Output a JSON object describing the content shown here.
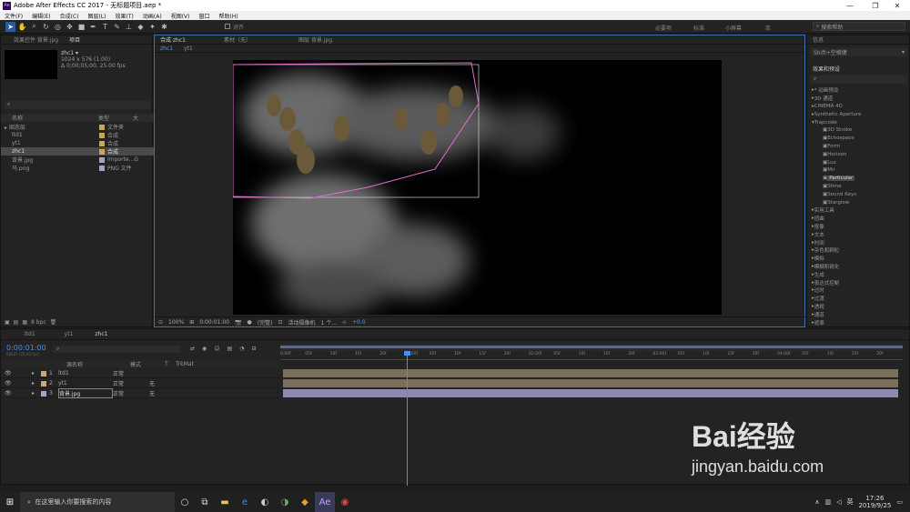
{
  "window": {
    "title": "Adobe After Effects CC 2017 - 无标题项目.aep *",
    "logo_text": "Ae",
    "min": "—",
    "max": "❐",
    "close": "✕"
  },
  "menu": [
    "文件(F)",
    "编辑(E)",
    "合成(C)",
    "图层(L)",
    "效果(T)",
    "动画(A)",
    "视图(V)",
    "窗口",
    "帮助(H)"
  ],
  "toolbar": {
    "align_label": "对齐",
    "workspaces": [
      "必要项",
      "标准",
      "小屏幕",
      "库"
    ],
    "help_search": "搜索帮助"
  },
  "project_panel": {
    "tab_effects": "效果控件 背景.jpg",
    "tab_project": "项目",
    "comp_name": "zhc1 ▾",
    "comp_info_1": "1024 x 576 (1.00)",
    "comp_info_2": "Δ 0;00;05;00, 25.00 fps",
    "col_name": "名称",
    "col_type": "类型",
    "col_size": "大",
    "items": [
      {
        "name": "固态层",
        "type": "文件夹",
        "color": "#c8a84e"
      },
      {
        "name": "ltd1",
        "type": "合成",
        "color": "#c8a84e"
      },
      {
        "name": "yt1",
        "type": "合成",
        "color": "#c8a84e"
      },
      {
        "name": "zhc1",
        "type": "合成",
        "color": "#c8a84e",
        "selected": true
      },
      {
        "name": "背景.jpg",
        "type": "Importe...G",
        "color": "#a4a4c8"
      },
      {
        "name": "马.png",
        "type": "PNG 文件",
        "color": "#a4a4c8"
      }
    ],
    "bpc": "8 bpc"
  },
  "comp_panel": {
    "tab_comp": "合成 zhc1",
    "tab_footage": "素材（无）",
    "tab_layer": "图层 背景.jpg",
    "subtab_1": "zhc1",
    "subtab_2": "yt1",
    "zoom": "100%",
    "time": "0:00:01:00",
    "quality": "(完整)",
    "camera": "活动摄像机",
    "views": "1 个...",
    "exposure": "+0.0"
  },
  "effects_panel": {
    "tab_preview": "信息",
    "shortcut": "Shift+空格键",
    "title": "效果和预设",
    "items": [
      {
        "label": "* 动画预设",
        "indent": 0
      },
      {
        "label": "3D 通道",
        "indent": 0
      },
      {
        "label": "CINEMA 4D",
        "indent": 0
      },
      {
        "label": "Synthetic Aperture",
        "indent": 0
      },
      {
        "label": "Trapcode",
        "indent": 0,
        "open": true
      },
      {
        "label": "3D Stroke",
        "indent": 1
      },
      {
        "label": "Echospace",
        "indent": 1
      },
      {
        "label": "Form",
        "indent": 1
      },
      {
        "label": "Horizon",
        "indent": 1
      },
      {
        "label": "Lux",
        "indent": 1
      },
      {
        "label": "Mir",
        "indent": 1
      },
      {
        "label": "Particular",
        "indent": 1,
        "selected": true
      },
      {
        "label": "Shine",
        "indent": 1
      },
      {
        "label": "Sound Keys",
        "indent": 1
      },
      {
        "label": "Starglow",
        "indent": 1
      },
      {
        "label": "实用工具",
        "indent": 0
      },
      {
        "label": "扭曲",
        "indent": 0
      },
      {
        "label": "抠像",
        "indent": 0
      },
      {
        "label": "文本",
        "indent": 0
      },
      {
        "label": "时间",
        "indent": 0
      },
      {
        "label": "杂色和颗粒",
        "indent": 0
      },
      {
        "label": "模拟",
        "indent": 0
      },
      {
        "label": "模糊和锐化",
        "indent": 0
      },
      {
        "label": "生成",
        "indent": 0
      },
      {
        "label": "表达式控制",
        "indent": 0
      },
      {
        "label": "过时",
        "indent": 0
      },
      {
        "label": "过渡",
        "indent": 0
      },
      {
        "label": "透视",
        "indent": 0
      },
      {
        "label": "通道",
        "indent": 0
      },
      {
        "label": "遮罩",
        "indent": 0
      }
    ]
  },
  "timeline": {
    "tabs": [
      "ltd1",
      "yt1",
      "zhc1"
    ],
    "timecode": "0:00:01:00",
    "timecode_sub": "00025 (25.00 fps)",
    "col_source": "源名称",
    "col_mode": "模式",
    "col_t": "T",
    "col_trkmat": "TrkMat",
    "ruler": [
      "0:00f",
      "05f",
      "10f",
      "15f",
      "20f",
      "01:00f",
      "05f",
      "10f",
      "15f",
      "20f",
      "02:00f",
      "05f",
      "10f",
      "15f",
      "20f",
      "03:00f",
      "05f",
      "10f",
      "15f",
      "20f",
      "04:00f",
      "05f",
      "10f",
      "15f",
      "20f"
    ],
    "layers": [
      {
        "num": "1",
        "name": "ltd1",
        "mode": "正常",
        "trkmat": "",
        "color": "#c8a87a"
      },
      {
        "num": "2",
        "name": "yt1",
        "mode": "正常",
        "trkmat": "无",
        "color": "#c8a87a"
      },
      {
        "num": "3",
        "name": "背景.jpg",
        "mode": "正常",
        "trkmat": "无",
        "color": "#a4a4c8"
      }
    ]
  },
  "taskbar": {
    "search_placeholder": "在这里输入你要搜索的内容",
    "time": "17:26",
    "date": "2019/9/25",
    "lang": "英"
  },
  "watermark": {
    "brand": "Bai经验",
    "url": "jingyan.baidu.com"
  }
}
